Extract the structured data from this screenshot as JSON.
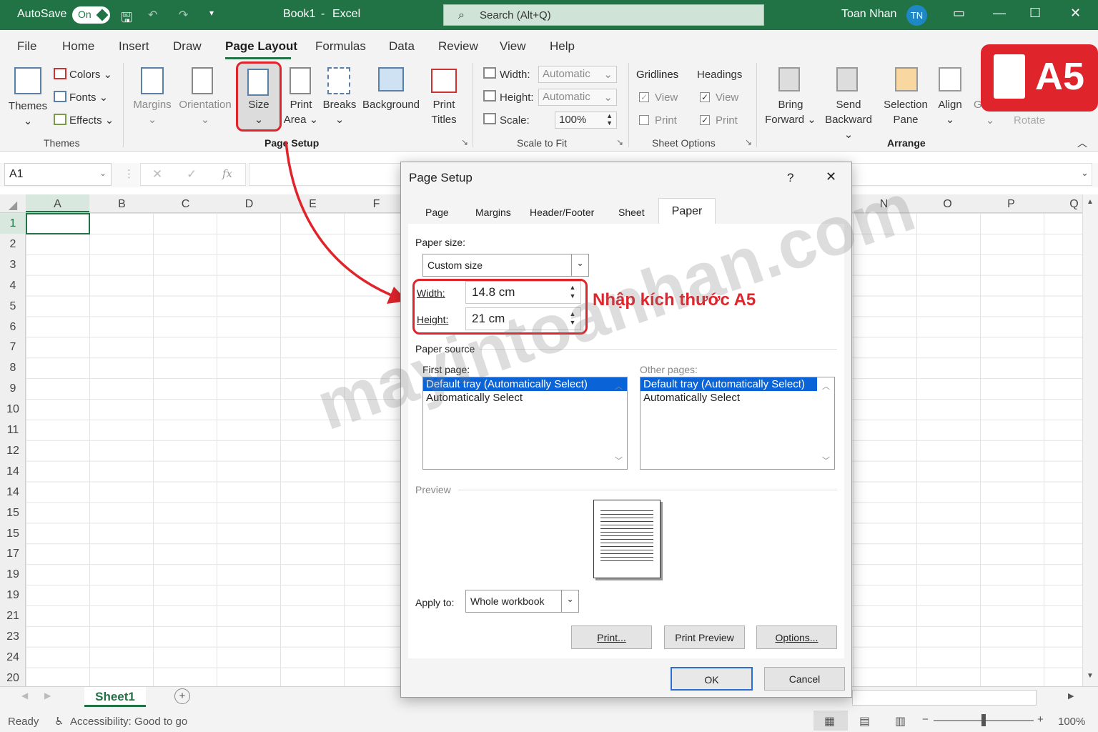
{
  "titlebar": {
    "autosave": "AutoSave",
    "toggle": "On",
    "document": "Book1",
    "sep": "-",
    "app": "Excel",
    "search_placeholder": "Search (Alt+Q)",
    "user": "Toan Nhan",
    "initials": "TN"
  },
  "menu": [
    "File",
    "Home",
    "Insert",
    "Draw",
    "Page Layout",
    "Formulas",
    "Data",
    "Review",
    "View",
    "Help"
  ],
  "ribbon": {
    "themes": {
      "themes": "Themes",
      "colors": "Colors",
      "fonts": "Fonts",
      "effects": "Effects",
      "group": "Themes"
    },
    "page_setup": {
      "margins": "Margins",
      "orientation": "Orientation",
      "size": "Size",
      "print_area_1": "Print",
      "print_area_2": "Area",
      "breaks": "Breaks",
      "background": "Background",
      "print_titles_1": "Print",
      "print_titles_2": "Titles",
      "group": "Page Setup"
    },
    "scale": {
      "width_label": "Width:",
      "width_value": "Automatic",
      "height_label": "Height:",
      "height_value": "Automatic",
      "scale_label": "Scale:",
      "scale_value": "100%",
      "group": "Scale to Fit"
    },
    "sheet_options": {
      "gridlines": "Gridlines",
      "headings": "Headings",
      "view": "View",
      "print": "Print",
      "group": "Sheet Options"
    },
    "arrange": {
      "bring_1": "Bring",
      "bring_2": "Forward",
      "send_1": "Send",
      "send_2": "Backward",
      "selection_1": "Selection",
      "selection_2": "Pane",
      "align": "Align",
      "group_short": "Gr",
      "rotate": "Rotate",
      "group": "Arrange"
    }
  },
  "formula": {
    "namebox": "A1",
    "fx": "fx"
  },
  "columns": [
    "A",
    "B",
    "C",
    "D",
    "E",
    "F",
    "N",
    "O",
    "P",
    "Q"
  ],
  "rows": [
    "1",
    "2",
    "3",
    "4",
    "5",
    "6",
    "7",
    "8",
    "9",
    "10",
    "11",
    "12",
    "14",
    "14",
    "15",
    "15",
    "17",
    "19",
    "19",
    "21",
    "23",
    "24",
    "20"
  ],
  "sheet": {
    "tab": "Sheet1"
  },
  "status": {
    "ready": "Ready",
    "accessibility": "Accessibility: Good to go",
    "zoom": "100%"
  },
  "dialog": {
    "title": "Page Setup",
    "help": "?",
    "close": "✕",
    "tabs": [
      "Page",
      "Margins",
      "Header/Footer",
      "Sheet",
      "Paper"
    ],
    "paper_size_label": "Paper size:",
    "paper_size_value": "Custom size",
    "width_label": "Width:",
    "width_value": "14.8 cm",
    "height_label": "Height:",
    "height_value": "21 cm",
    "paper_source_label": "Paper source",
    "first_page_label": "First page:",
    "other_pages_label": "Other pages:",
    "first_page_items": [
      "Default tray (Automatically Select)",
      "Automatically Select"
    ],
    "other_pages_items": [
      "Default tray (Automatically Select)",
      "Automatically Select"
    ],
    "preview_label": "Preview",
    "apply_label": "Apply to:",
    "apply_value": "Whole workbook",
    "print_btn": "Print...",
    "preview_btn": "Print Preview",
    "options_btn": "Options...",
    "ok_btn": "OK",
    "cancel_btn": "Cancel"
  },
  "annotation": "Nhập kích thước A5",
  "badge": "A5",
  "watermark": "mayintoanhan.com",
  "colors": {
    "excel_green": "#217346",
    "annotation_red": "#e0242b",
    "selection_blue": "#0a64d8"
  }
}
